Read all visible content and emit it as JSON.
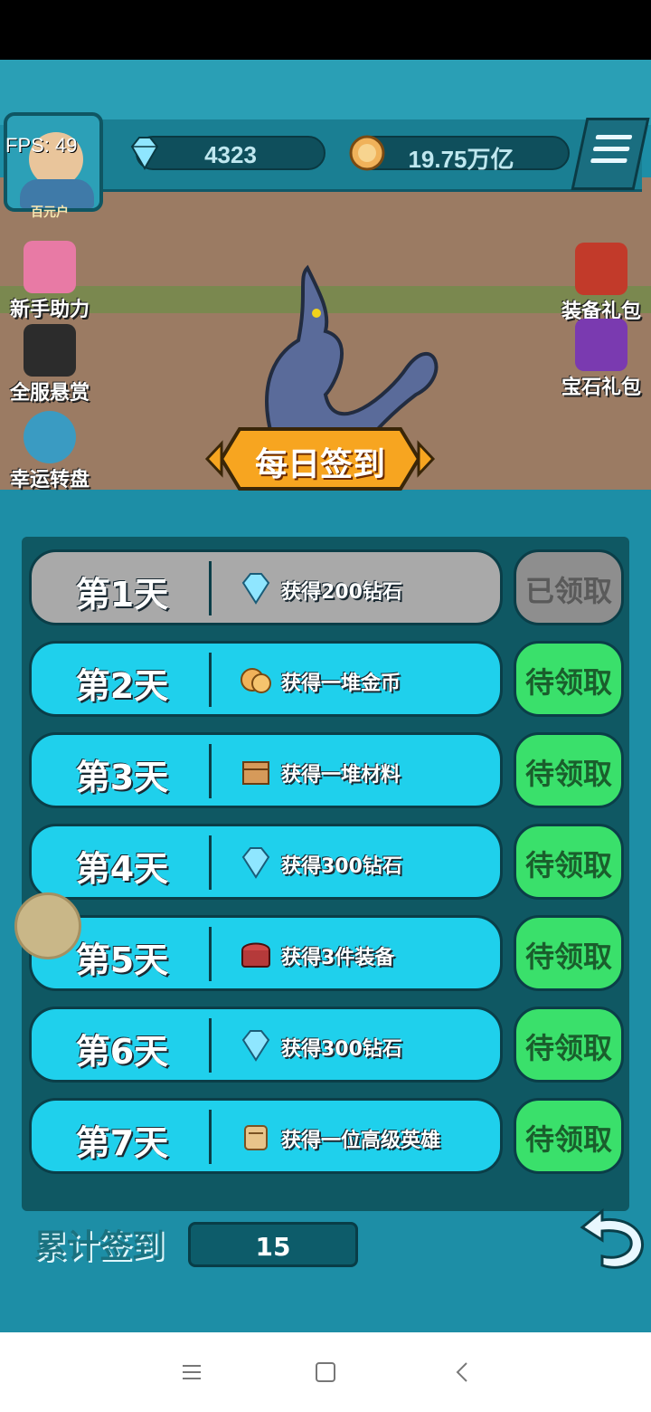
{
  "hud": {
    "fps_label": "FPS: 49",
    "diamonds": "4323",
    "coins": "19.75万亿",
    "avatar_tag": "百元户"
  },
  "side_left": [
    {
      "label": "新手助力",
      "icon": "gift-icon"
    },
    {
      "label": "全服悬赏",
      "icon": "bounty-icon"
    },
    {
      "label": "幸运转盘",
      "icon": "wheel-icon"
    }
  ],
  "side_right": [
    {
      "label": "装备礼包",
      "icon": "equipment-gift-icon"
    },
    {
      "label": "宝石礼包",
      "icon": "gem-gift-icon"
    }
  ],
  "banner": {
    "title": "每日签到"
  },
  "days": [
    {
      "day": "第1天",
      "reward": "获得200钻石",
      "icon": "diamond-icon",
      "status": "已领取"
    },
    {
      "day": "第2天",
      "reward": "获得一堆金币",
      "icon": "coins-icon",
      "status": "待领取"
    },
    {
      "day": "第3天",
      "reward": "获得一堆材料",
      "icon": "box-icon",
      "status": "待领取"
    },
    {
      "day": "第4天",
      "reward": "获得300钻石",
      "icon": "diamond-icon",
      "status": "待领取"
    },
    {
      "day": "第5天",
      "reward": "获得3件装备",
      "icon": "chest-icon",
      "status": "待领取"
    },
    {
      "day": "第6天",
      "reward": "获得300钻石",
      "icon": "diamond-icon",
      "status": "待领取"
    },
    {
      "day": "第7天",
      "reward": "获得一位高级英雄",
      "icon": "scroll-icon",
      "status": "待领取"
    }
  ],
  "cumulative": {
    "label": "累计签到",
    "value": "15"
  },
  "colors": {
    "active_row": "#1fd0ec",
    "claimed_row": "#a9a9a9",
    "pending_button": "#3ae06b",
    "panel": "#0f5863"
  }
}
